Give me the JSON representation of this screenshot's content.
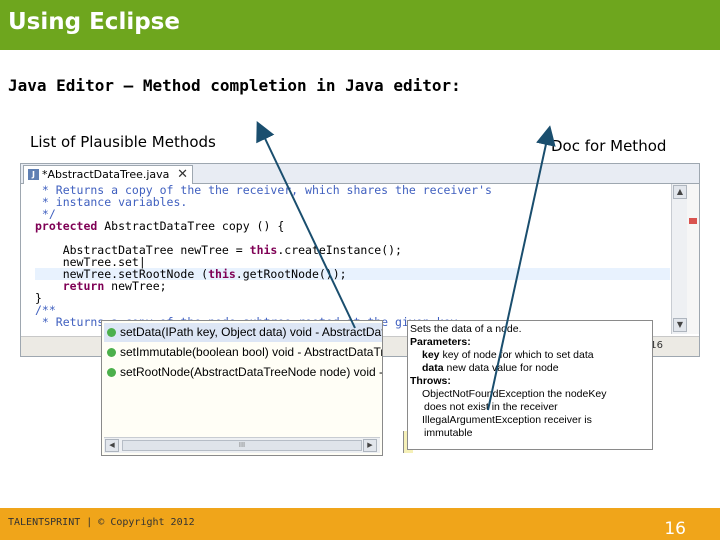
{
  "slide": {
    "title": "Using Eclipse",
    "subtitle": "Java Editor – Method completion in Java editor:",
    "label_left": "List of Plausible Methods",
    "label_right": "Doc for Method",
    "footer": "TALENTSPRINT | © Copyright 2012",
    "page_number": "16"
  },
  "editor": {
    "tab_label": "*AbstractDataTree.java",
    "tab_icon": "J",
    "tab_close": "✕",
    "status_number": "16",
    "code": [
      {
        "parts": [
          {
            "text": " * Returns a copy of the the receiver, which shares the receiver's",
            "style": "comment"
          }
        ]
      },
      {
        "parts": [
          {
            "text": " * instance variables.",
            "style": "comment"
          }
        ]
      },
      {
        "parts": [
          {
            "text": " */",
            "style": "comment"
          }
        ]
      },
      {
        "parts": [
          {
            "text": "protected",
            "style": "kw"
          },
          {
            "text": " AbstractDataTree copy () {",
            "style": "plain"
          }
        ]
      },
      {
        "parts": [
          {
            "text": "",
            "style": "plain"
          }
        ]
      },
      {
        "parts": [
          {
            "text": "    AbstractDataTree newTree = ",
            "style": "plain"
          },
          {
            "text": "this",
            "style": "kw"
          },
          {
            "text": ".createInstance();",
            "style": "plain"
          }
        ]
      },
      {
        "parts": [
          {
            "text": "    newTree.set|",
            "style": "plain"
          }
        ]
      },
      {
        "parts": [
          {
            "text": "    newTree.setRootNode (",
            "style": "plain"
          },
          {
            "text": "this",
            "style": "kw"
          },
          {
            "text": ".getRootNode());",
            "style": "plain"
          }
        ]
      },
      {
        "parts": [
          {
            "text": "    ",
            "style": "plain"
          },
          {
            "text": "return",
            "style": "kw"
          },
          {
            "text": " newTree;",
            "style": "plain"
          }
        ]
      },
      {
        "parts": [
          {
            "text": "}",
            "style": "plain"
          }
        ]
      },
      {
        "parts": [
          {
            "text": "/**",
            "style": "comment"
          }
        ]
      },
      {
        "parts": [
          {
            "text": " * Returns a copy of the node subtree rooted at the given key.",
            "style": "comment"
          }
        ]
      }
    ]
  },
  "completion": {
    "items": [
      "setData(IPath key, Object data)  void - AbstractDataTree",
      "setImmutable(boolean bool)  void - AbstractDataTree",
      "setRootNode(AbstractDataTreeNode node)  void - AbstractDataTree"
    ],
    "scroll_thumb": "III"
  },
  "doc": {
    "summary": "Sets the data of a node.",
    "params_heading": "Parameters:",
    "param1_name": "key",
    "param1_desc": " key of node for which to set data",
    "param2_name": "data",
    "param2_desc": " new data value for node",
    "throws_heading": "Throws:",
    "throws": [
      "ObjectNotFoundException the nodeKey",
      "does not exist in the receiver",
      "IllegalArgumentException receiver is",
      "immutable"
    ]
  },
  "colors": {
    "title_bar": "#6ea61e",
    "footer_bar": "#f0a51a",
    "arrow": "#1a4e6e",
    "keyword": "#7f0055",
    "comment": "#3f5fbf"
  }
}
